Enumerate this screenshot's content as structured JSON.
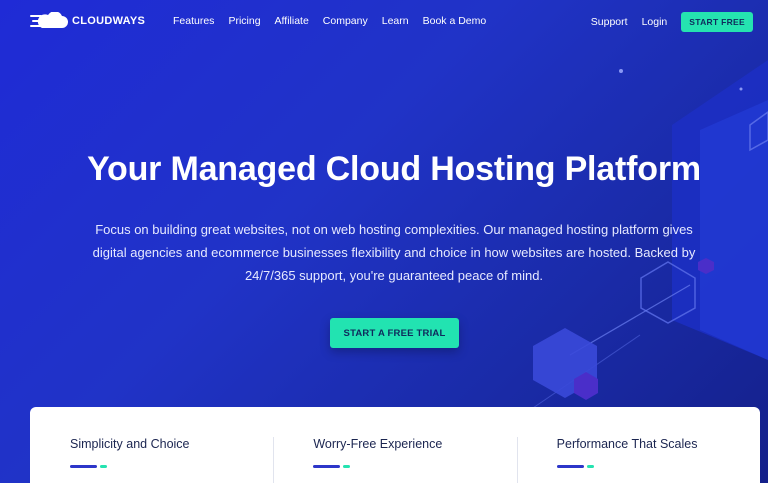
{
  "brand": {
    "name": "CLOUDWAYS"
  },
  "nav": {
    "links": [
      "Features",
      "Pricing",
      "Affiliate",
      "Company",
      "Learn",
      "Book a Demo"
    ],
    "support": "Support",
    "login": "Login",
    "start_free": "START FREE"
  },
  "hero": {
    "title": "Your Managed Cloud Hosting Platform",
    "subtitle": "Focus on building great websites, not on web hosting complexities. Our managed hosting platform gives digital agencies and ecommerce businesses flexibility and choice in how websites are hosted. Backed by 24/7/365 support, you're guaranteed peace of mind.",
    "cta": "START A FREE TRIAL"
  },
  "features": [
    {
      "title": "Simplicity and Choice"
    },
    {
      "title": "Worry-Free Experience"
    },
    {
      "title": "Performance That Scales"
    }
  ],
  "colors": {
    "accent": "#25e3b0",
    "primary": "#2033c7",
    "dark_text": "#1b2550"
  }
}
